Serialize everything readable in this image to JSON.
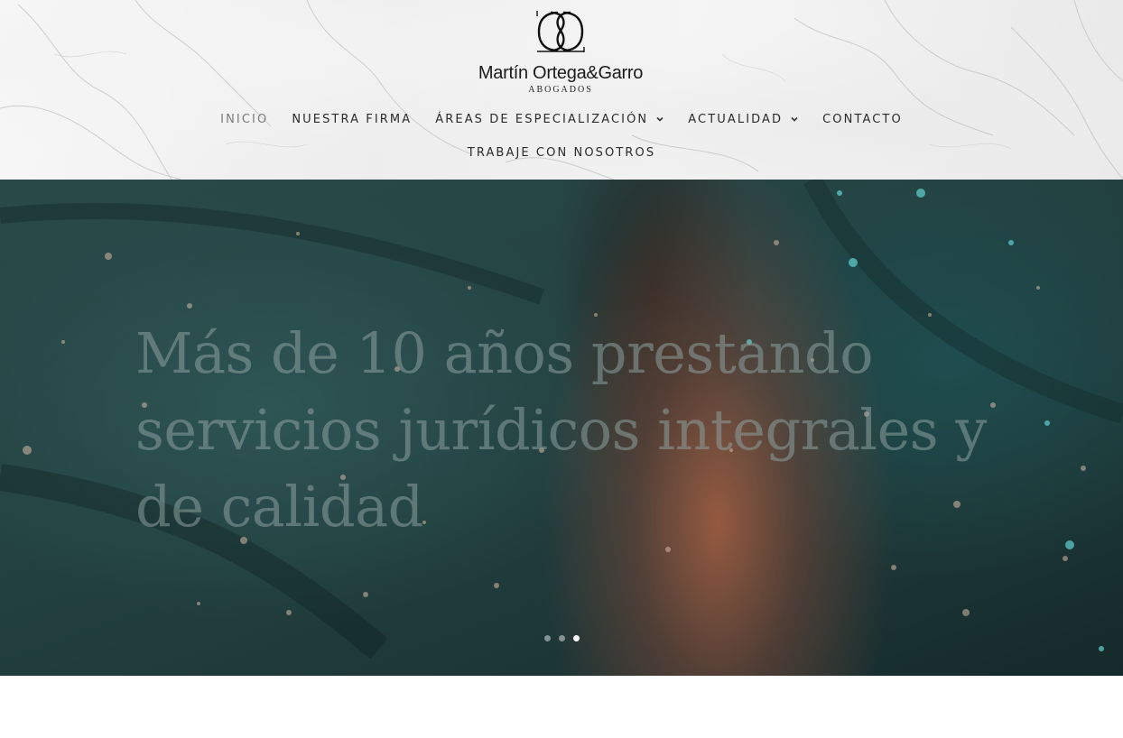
{
  "header": {
    "logo": {
      "name": "Martín Ortega&Garro",
      "subtitle": "ABOGADOS"
    },
    "nav": {
      "row1": [
        {
          "label": "INICIO",
          "active": true,
          "has_dropdown": false
        },
        {
          "label": "NUESTRA FIRMA",
          "active": false,
          "has_dropdown": false
        },
        {
          "label": "ÁREAS DE ESPECIALIZACIÓN",
          "active": false,
          "has_dropdown": true
        },
        {
          "label": "ACTUALIDAD",
          "active": false,
          "has_dropdown": true
        },
        {
          "label": "CONTACTO",
          "active": false,
          "has_dropdown": false
        }
      ],
      "row2": [
        {
          "label": "TRABAJE CON NOSOTROS",
          "active": false,
          "has_dropdown": false
        }
      ]
    }
  },
  "hero": {
    "title": "Más de 10 años prestando servicios jurídicos integrales y de calidad",
    "slides": {
      "count": 3,
      "active_index": 3
    }
  },
  "colors": {
    "nav_text": "#2b2b2b",
    "nav_active": "#7a7a7a",
    "hero_dark": "#244242",
    "hero_accent": "#aa5f41"
  },
  "icons": [
    "logo-monogram-icon",
    "chevron-down-icon"
  ]
}
